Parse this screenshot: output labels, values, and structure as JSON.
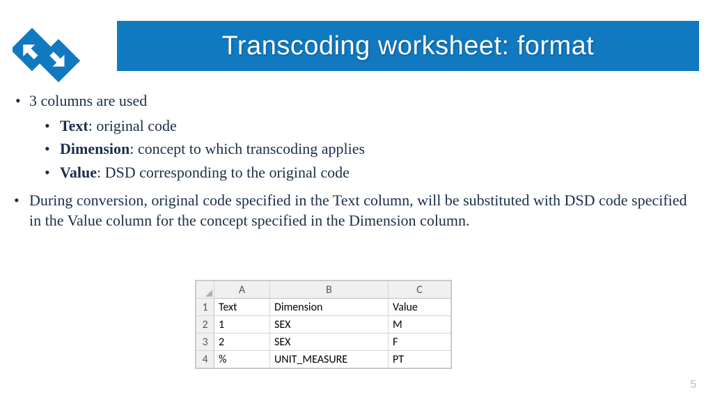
{
  "title": "Transcoding worksheet: format",
  "bullets": {
    "b1": "3 columns are used",
    "sub1_bold": "Text",
    "sub1_rest": ": original code",
    "sub2_bold": "Dimension",
    "sub2_rest": ": concept to which transcoding applies",
    "sub3_bold": "Value",
    "sub3_rest": ": DSD corresponding to the original code",
    "b2": "During conversion, original code specified in the Text column, will be substituted with DSD code specified in the Value column for the concept specified in the Dimension column."
  },
  "sheet": {
    "cols": [
      "A",
      "B",
      "C"
    ],
    "header": [
      "Text",
      "Dimension",
      "Value"
    ],
    "rows": [
      {
        "n": "1",
        "a": "Text",
        "b": "Dimension",
        "c": "Value"
      },
      {
        "n": "2",
        "a": "1",
        "b": "SEX",
        "c": "M"
      },
      {
        "n": "3",
        "a": "2",
        "b": "SEX",
        "c": "F"
      },
      {
        "n": "4",
        "a": "%",
        "b": "UNIT_MEASURE",
        "c": "PT"
      }
    ]
  },
  "page_number": "5"
}
